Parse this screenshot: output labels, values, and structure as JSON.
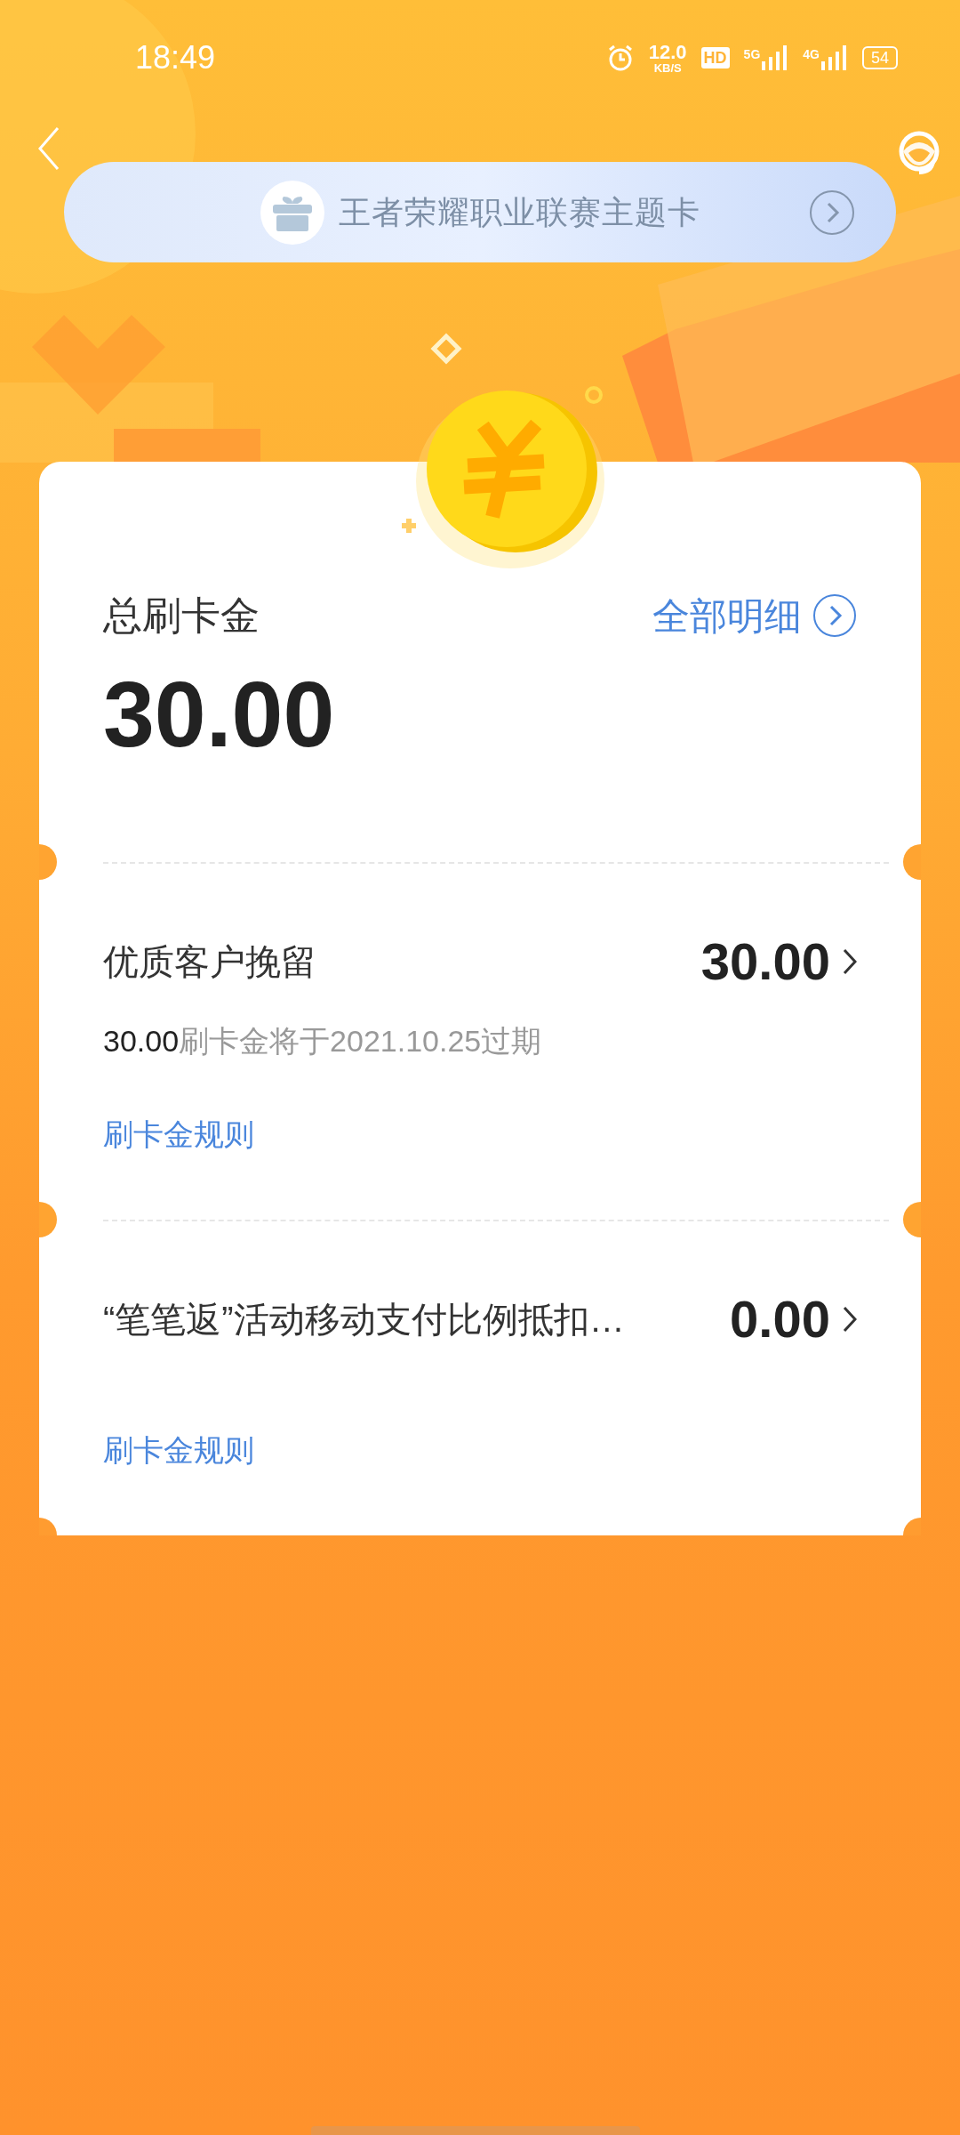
{
  "status_bar": {
    "time": "18:49",
    "net_speed": "12.0",
    "net_unit": "KB/S",
    "hd": "HD",
    "signal_1": "5G",
    "signal_2": "4G",
    "battery": "54"
  },
  "banner": {
    "title": "王者荣耀职业联赛主题卡"
  },
  "summary": {
    "label": "总刷卡金",
    "details_link": "全部明细",
    "amount": "30.00"
  },
  "items": [
    {
      "title": "优质客户挽留",
      "amount": "30.00",
      "note_amount": "30.00",
      "note_text": "刷卡金将于2021.10.25过期",
      "rules_link": "刷卡金规则"
    },
    {
      "title": "“笔笔返”活动移动支付比例抵扣…",
      "amount": "0.00",
      "rules_link": "刷卡金规则"
    }
  ]
}
